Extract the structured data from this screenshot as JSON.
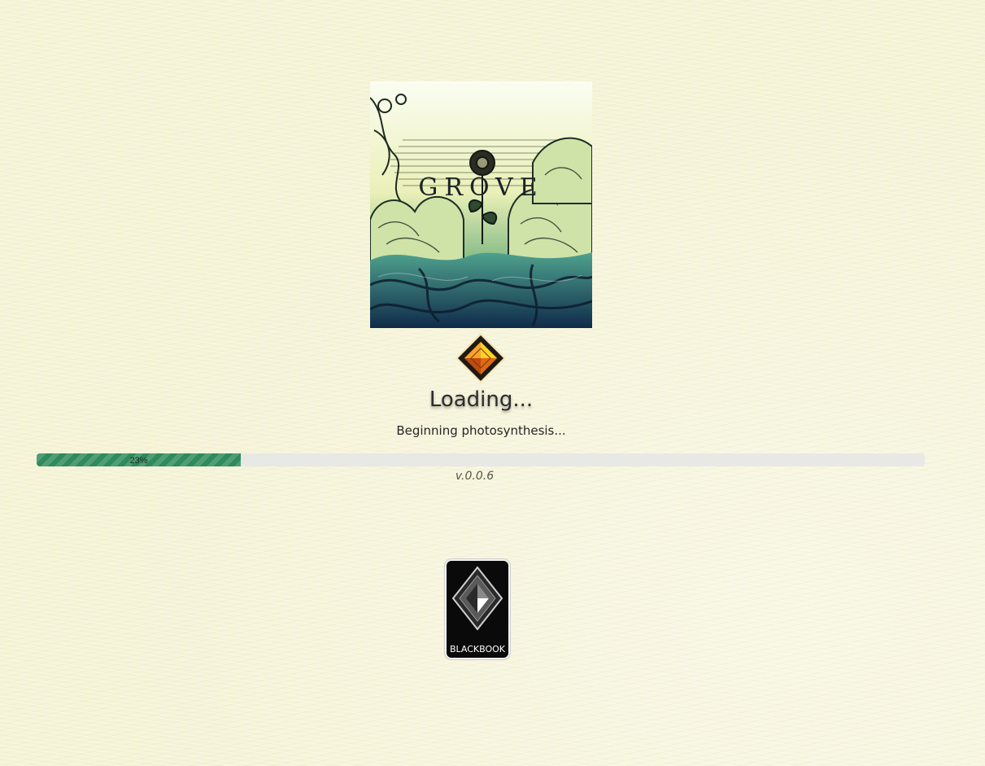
{
  "cover": {
    "title": "GROVE"
  },
  "icons": {
    "loading": "diamond-gem-icon",
    "publisher": "blackbook-logo-icon"
  },
  "loading": {
    "heading": "Loading...",
    "status": "Beginning photosynthesis...",
    "progress_label": "23%",
    "progress_fraction": 0.23,
    "version": "v.0.0.6"
  },
  "publisher": {
    "label": "BLACKBOOK"
  },
  "colors": {
    "background": "#f5f3d6",
    "progress_fill": "#2f8a5c",
    "progress_track": "#e8e8e6",
    "gem_orange": "#f08a1a",
    "gem_yellow": "#ffd22a"
  }
}
